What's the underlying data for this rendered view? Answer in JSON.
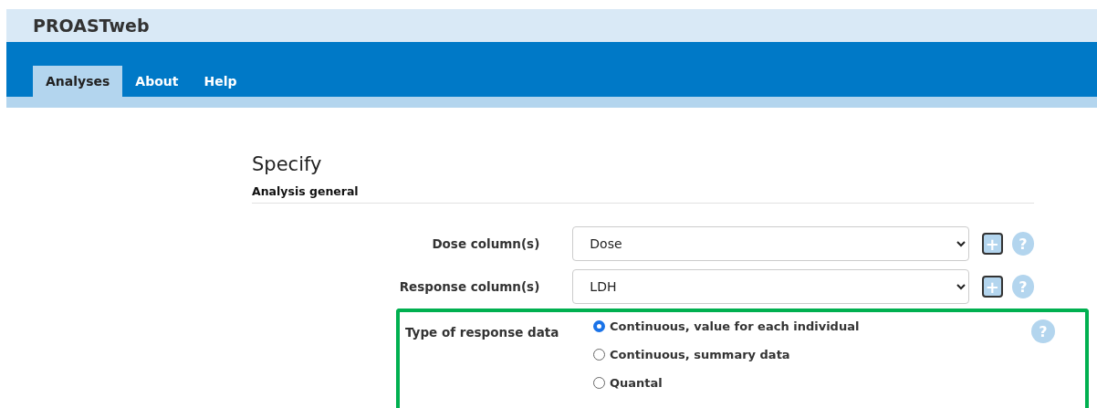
{
  "app_title": "PROASTweb",
  "tabs": [
    {
      "label": "Analyses",
      "selected": true
    },
    {
      "label": "About",
      "selected": false
    },
    {
      "label": "Help",
      "selected": false
    }
  ],
  "heading": "Specify",
  "section": "Analysis general",
  "fields": [
    {
      "label": "Dose column(s)",
      "value": "Dose",
      "add": "+",
      "help": "?"
    },
    {
      "label": "Response column(s)",
      "value": "LDH",
      "add": "+",
      "help": "?"
    }
  ],
  "response_type": {
    "label": "Type of response data",
    "help": "?",
    "highlighted": true,
    "options": [
      {
        "label": "Continuous, value for each individual",
        "selected": true
      },
      {
        "label": "Continuous, summary data",
        "selected": false
      },
      {
        "label": "Quantal",
        "selected": false
      }
    ]
  }
}
